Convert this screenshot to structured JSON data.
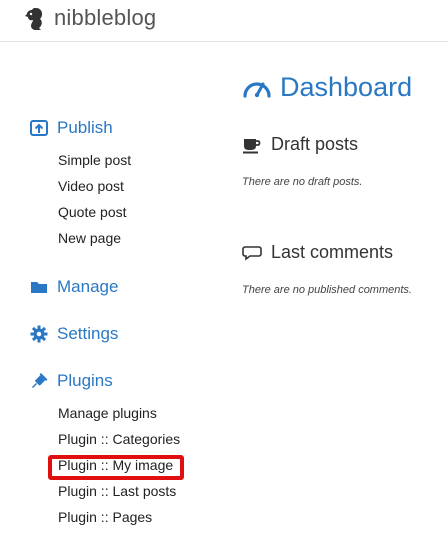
{
  "header": {
    "brand": "nibbleblog"
  },
  "sidebar": {
    "publish": {
      "label": "Publish",
      "items": [
        "Simple post",
        "Video post",
        "Quote post",
        "New page"
      ]
    },
    "manage": {
      "label": "Manage"
    },
    "settings": {
      "label": "Settings"
    },
    "plugins": {
      "label": "Plugins",
      "items": [
        "Manage plugins",
        "Plugin :: Categories",
        "Plugin :: My image",
        "Plugin :: Last posts",
        "Plugin :: Pages"
      ]
    }
  },
  "main": {
    "title": "Dashboard",
    "draft_posts": {
      "title": "Draft posts",
      "empty": "There are no draft posts."
    },
    "last_comments": {
      "title": "Last comments",
      "empty": "There are no published comments."
    }
  },
  "colors": {
    "accent": "#2a78c4",
    "highlight": "#e01010"
  },
  "icons": {
    "logo": "squirrel-icon",
    "publish": "upload-icon",
    "manage": "folder-icon",
    "settings": "gear-icon",
    "plugins": "plug-icon",
    "dashboard": "gauge-icon",
    "draft_posts": "coffee-icon",
    "last_comments": "comment-icon"
  }
}
